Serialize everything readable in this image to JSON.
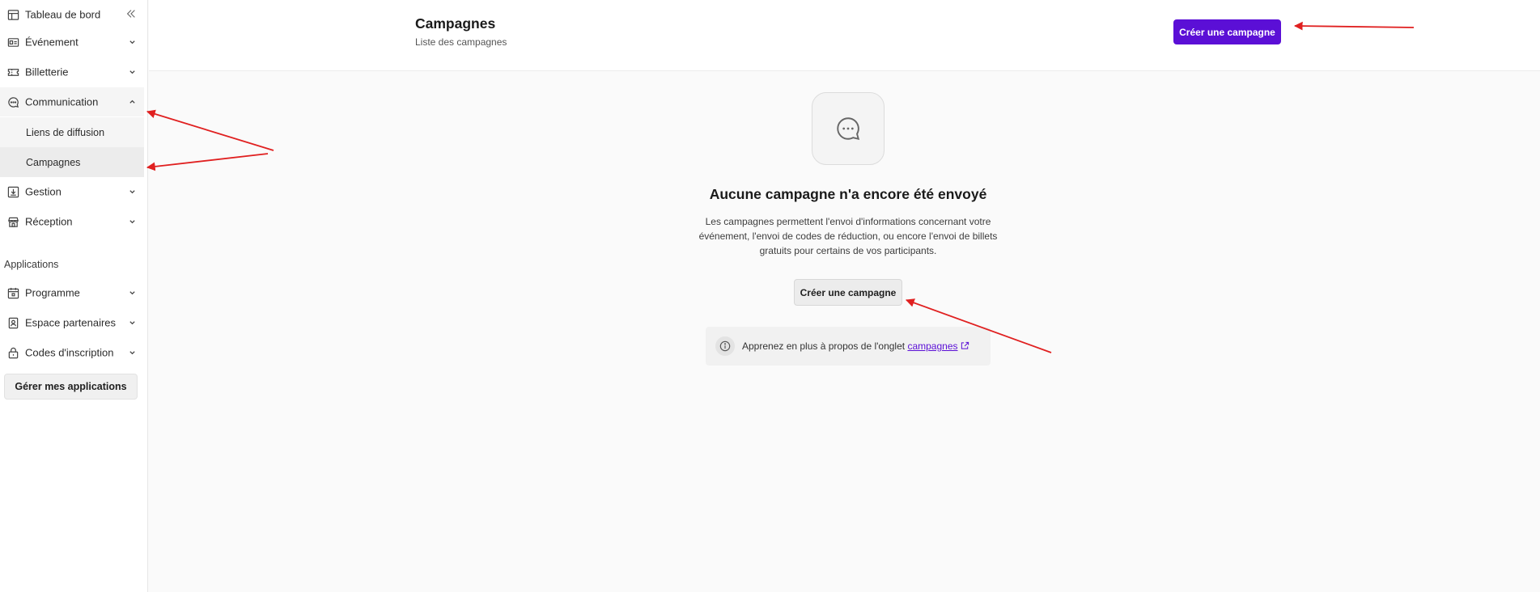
{
  "sidebar": {
    "items": [
      {
        "label": "Tableau de bord",
        "icon": "layout-icon"
      },
      {
        "label": "Événement",
        "icon": "id-card-icon"
      },
      {
        "label": "Billetterie",
        "icon": "ticket-icon"
      },
      {
        "label": "Communication",
        "icon": "chat-icon"
      },
      {
        "label": "Gestion",
        "icon": "download-icon"
      },
      {
        "label": "Réception",
        "icon": "store-icon"
      }
    ],
    "communication_sub": [
      {
        "label": "Liens de diffusion"
      },
      {
        "label": "Campagnes"
      }
    ],
    "applications_label": "Applications",
    "apps": [
      {
        "label": "Programme",
        "icon": "calendar-icon"
      },
      {
        "label": "Espace partenaires",
        "icon": "contact-icon"
      },
      {
        "label": "Codes d'inscription",
        "icon": "lock-icon"
      }
    ],
    "manage_apps_label": "Gérer mes applications"
  },
  "header": {
    "title": "Campagnes",
    "subtitle": "Liste des campagnes",
    "create_label": "Créer une campagne"
  },
  "empty_state": {
    "icon": "chat-bubble-icon",
    "title": "Aucune campagne n'a encore été envoyé",
    "description": "Les campagnes permettent l'envoi d'informations concernant votre événement, l'envoi de codes de réduction, ou encore l'envoi de billets gratuits pour certains de vos participants.",
    "create_label": "Créer une campagne",
    "info_prefix": "Apprenez en plus à propos de l'onglet",
    "info_link": "campagnes"
  },
  "colors": {
    "accent": "#5b0fd6",
    "annotation_arrow": "#e02020"
  }
}
